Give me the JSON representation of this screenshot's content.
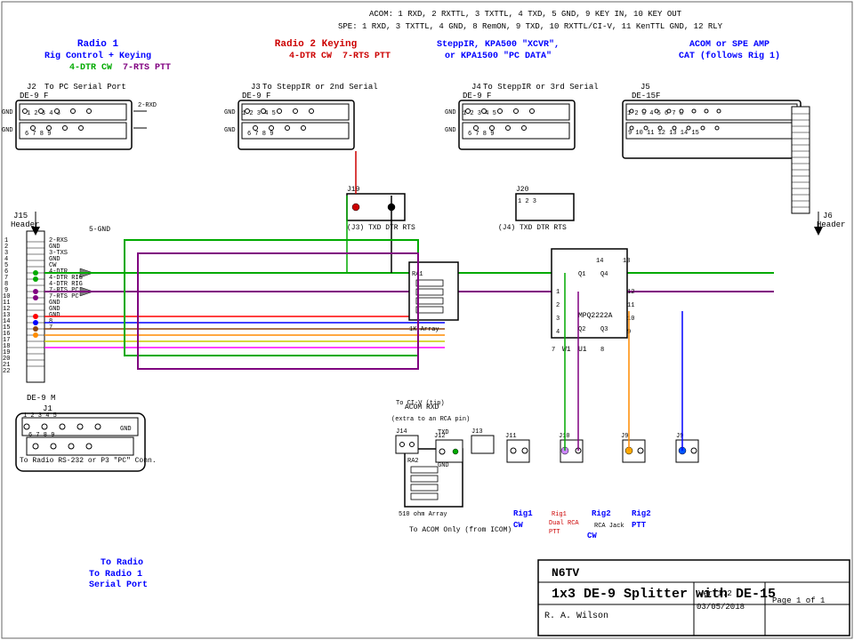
{
  "title": "1x3 DE-9 Splitter with DE-15",
  "author": "R. A. Wilson",
  "version": "Ver 1.2",
  "date": "03/05/2018",
  "page": "Page 1 of 1",
  "callsign": "N6TV",
  "labels": {
    "radio1_title": "Radio 1",
    "radio1_sub": "Rig Control + Keying",
    "radio1_dtr": "4-DTR CW",
    "radio1_rts": "7-RTS PTT",
    "radio2_title": "Radio 2 Keying",
    "radio2_dtr": "4-DTR CW",
    "radio2_rts": "7-RTS PTT",
    "steppir_title": "SteppIR, KPA500 \"XCVR\",",
    "steppir_sub": "or KPA1500 \"PC DATA\"",
    "acom_title": "ACOM or SPE AMP",
    "acom_sub": "CAT (follows Rig 1)",
    "acom_header": "ACOM: 1 RXD, 2 RXTTL, 3 TXTTL, 4 TXD, 5 GND, 9 KEY IN, 10 KEY OUT",
    "spe_header": "SPE:  1 RXD, 3 TXTTL, 4 GND, 8 RemON, 9 TXD, 10 RXTTL/CI-V, 11 KenTTL GND, 12 RLY",
    "j2_label": "J2",
    "j2_sub": "DE-9 F",
    "j3_label": "J3",
    "j3_sub": "DE-9 F",
    "j4_label": "J4",
    "j4_sub": "DE-9 F",
    "j5_label": "J5",
    "j5_sub": "DE-15F",
    "j15_label": "J15",
    "j15_sub": "Header",
    "j6_label": "J6",
    "j6_sub": "Header",
    "j1_label": "J1",
    "de9m_label": "DE-9 M",
    "j1t_label": "J1",
    "to_pc_serial": "To PC Serial Port",
    "to_steppir_2": "To SteppIR or 2nd Serial",
    "to_steppir_3": "To SteppIR or 3rd Serial",
    "to_radio_serial": "To Radio RS-232 or P3 \"PC\" Conn.",
    "to_radio1_serial_port": "To Radio 1\nSerial Port",
    "to_radio": "To Radio",
    "rig1_cw": "Rig1\nCW",
    "rig1_ptt": "Rig1\nPTT",
    "rig2_cw": "Rig2\nCW",
    "rig2_ptt": "Rig2\nPTT",
    "ra1_label": "RA1",
    "ra1_sub": "1K Array",
    "ra2_label": "RA2",
    "ra2_sub": "510 ohm Array",
    "to_acom": "To ACOM Only (from ICOM)",
    "mpq_label": "MPQ2222A",
    "w1_label": "W1",
    "u1_label": "U1",
    "j19_label": "J19",
    "j20_label": "J20",
    "j9_label": "J9",
    "j10_label": "J10",
    "j11_label": "J11",
    "j12_label": "J12",
    "j13_label": "J13",
    "j14_label": "J14",
    "acom_rxd": "ACOM RXD",
    "extra_rca": "(extra to an RCA pin)",
    "to_ci_v": "To CI-V (tip)"
  },
  "colors": {
    "red": "#ff0000",
    "green": "#00aa00",
    "blue": "#0000ff",
    "purple": "#800080",
    "orange": "#ff8c00",
    "yellow": "#cccc00",
    "brown": "#8b4513",
    "black": "#000000",
    "magenta": "#ff00ff",
    "cyan": "#00aaaa",
    "radio1_color": "#0000ff",
    "radio2_color": "#cc0000",
    "steppir_color": "#0000ff",
    "acom_color": "#0000ff",
    "dtr_color": "#00aa00",
    "rts_color": "#800080"
  }
}
